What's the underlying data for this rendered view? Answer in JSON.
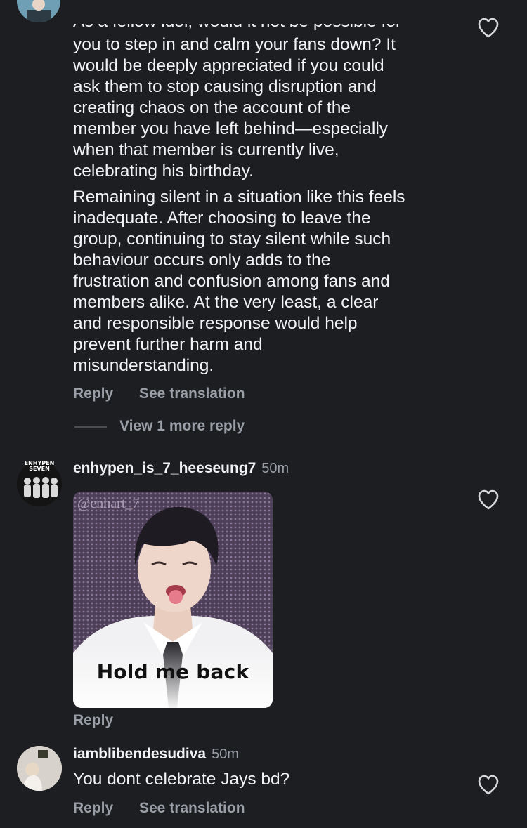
{
  "comment1": {
    "clipped_line": "As a fellow idol, would it not be possible for",
    "paragraph1": "you to step in and calm your fans down? It\nwould be deeply appreciated if you could\nask them to stop causing disruption and\ncreating chaos on the account of the\nmember you have left behind—especially\nwhen that member is currently live,\ncelebrating his birthday.",
    "paragraph2": "Remaining silent in a situation like this feels\ninadequate. After choosing to leave the\ngroup, continuing to stay silent while such\nbehaviour occurs only adds to the\nfrustration and confusion among fans and\nmembers alike. At the very least, a clear\nand responsible response would help\nprevent further harm and\nmisunderstanding.",
    "reply_label": "Reply",
    "translate_label": "See translation",
    "view_more_label": "View 1 more reply"
  },
  "comment2": {
    "username": "enhypen_is_7_heeseung7",
    "time": "50m",
    "avatar_text_top": "ENHYPEN",
    "avatar_text_bottom": "SEVEN",
    "gif": {
      "watermark": "@enhart_7",
      "caption": "Hold me back"
    },
    "reply_label": "Reply"
  },
  "comment3": {
    "username": "iamblibendesudiva",
    "time": "50m",
    "text": "You dont celebrate Jays bd?",
    "reply_label": "Reply",
    "translate_label": "See translation"
  },
  "icons": {
    "like": "heart-outline-icon"
  },
  "colors": {
    "background": "#1c1e21",
    "text_primary": "#f2f3f5",
    "text_secondary": "#9a9ea6"
  }
}
